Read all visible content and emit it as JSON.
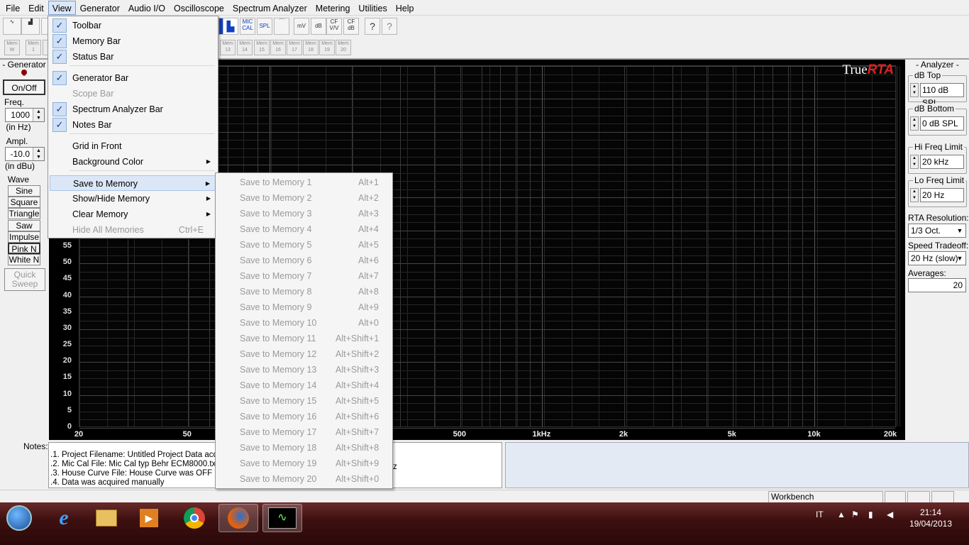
{
  "menubar": [
    "File",
    "Edit",
    "View",
    "Generator",
    "Audio I/O",
    "Oscilloscope",
    "Spectrum Analyzer",
    "Metering",
    "Utilities",
    "Help"
  ],
  "toolbar": {
    "buttons": [
      "MIC CAL",
      "SPL",
      "mV",
      "dB",
      "CF V/V",
      "CF dB",
      "?",
      "?"
    ],
    "mem_label": "Mem",
    "mem_numbers": [
      "W",
      "1",
      "13",
      "14",
      "15",
      "16",
      "17",
      "18",
      "19",
      "20"
    ]
  },
  "generator": {
    "title": "- Generator -",
    "onoff": "On/Off",
    "freq_label": "Freq.",
    "freq_value": "1000",
    "freq_unit": "(in Hz)",
    "ampl_label": "Ampl.",
    "ampl_value": "-10.0",
    "ampl_unit": "(in dBu)",
    "wave_label": "Wave",
    "waves": [
      "Sine",
      "Square",
      "Triangle",
      "Saw",
      "Impulse",
      "Pink N",
      "White N"
    ],
    "quick_sweep": "Quick Sweep"
  },
  "chart_data": {
    "type": "line",
    "logo_text": "True",
    "logo_accent": "RTA",
    "y_ticks": [
      "55",
      "50",
      "45",
      "40",
      "35",
      "30",
      "25",
      "20",
      "15",
      "10",
      "5",
      "0"
    ],
    "x_ticks": [
      "20",
      "50",
      "500",
      "1kHz",
      "2k",
      "5k",
      "10k",
      "20k"
    ],
    "xscale": "log",
    "xlim": [
      20,
      20000
    ],
    "series": []
  },
  "analyzer": {
    "title": "- Analyzer -",
    "db_top_label": "dB Top",
    "db_top_value": "110 dB SPL",
    "db_bottom_label": "dB Bottom",
    "db_bottom_value": "0 dB SPL",
    "hi_freq_label": "Hi Freq Limit",
    "hi_freq_value": "20 kHz",
    "lo_freq_label": "Lo Freq Limit",
    "lo_freq_value": "20 Hz",
    "rta_res_label": "RTA Resolution:",
    "rta_res_value": "1/3 Oct.",
    "speed_label": "Speed Tradeoff:",
    "speed_value": "20 Hz (slow)",
    "averages_label": "Averages:",
    "averages_value": "20"
  },
  "notes": {
    "label": "Notes:",
    "lines": [
      ".1. Project Filename: Untitled Project      Data acq",
      ".2. Mic Cal File: Mic Cal typ Behr ECM8000.txt",
      ".3. House Curve File: House Curve was OFF",
      ".4. Data was acquired manually"
    ],
    "tail": "z"
  },
  "statusbar": {
    "workbench": "Workbench"
  },
  "view_menu": {
    "items": [
      {
        "label": "Toolbar",
        "checked": true
      },
      {
        "label": "Memory Bar",
        "checked": true
      },
      {
        "label": "Status Bar",
        "checked": true
      },
      {
        "label": "Generator Bar",
        "checked": true
      },
      {
        "label": "Scope Bar",
        "checked": false,
        "disabled": true
      },
      {
        "label": "Spectrum Analyzer Bar",
        "checked": true
      },
      {
        "label": "Notes Bar",
        "checked": true
      },
      {
        "label": "Grid in Front"
      },
      {
        "label": "Background Color",
        "submenu": true
      },
      {
        "label": "Save to Memory",
        "submenu": true,
        "highlighted": true
      },
      {
        "label": "Show/Hide Memory",
        "submenu": true
      },
      {
        "label": "Clear Memory",
        "submenu": true
      },
      {
        "label": "Hide All Memories",
        "shortcut": "Ctrl+E",
        "disabled": true
      }
    ],
    "check_glyph": "✓",
    "arrow_glyph": "▶"
  },
  "memory_submenu": [
    {
      "label": "Save to Memory 1",
      "shortcut": "Alt+1"
    },
    {
      "label": "Save to Memory 2",
      "shortcut": "Alt+2"
    },
    {
      "label": "Save to Memory 3",
      "shortcut": "Alt+3"
    },
    {
      "label": "Save to Memory 4",
      "shortcut": "Alt+4"
    },
    {
      "label": "Save to Memory 5",
      "shortcut": "Alt+5"
    },
    {
      "label": "Save to Memory 6",
      "shortcut": "Alt+6"
    },
    {
      "label": "Save to Memory 7",
      "shortcut": "Alt+7"
    },
    {
      "label": "Save to Memory 8",
      "shortcut": "Alt+8"
    },
    {
      "label": "Save to Memory 9",
      "shortcut": "Alt+9"
    },
    {
      "label": "Save to Memory 10",
      "shortcut": "Alt+0"
    },
    {
      "label": "Save to Memory 11",
      "shortcut": "Alt+Shift+1"
    },
    {
      "label": "Save to Memory 12",
      "shortcut": "Alt+Shift+2"
    },
    {
      "label": "Save to Memory 13",
      "shortcut": "Alt+Shift+3"
    },
    {
      "label": "Save to Memory 14",
      "shortcut": "Alt+Shift+4"
    },
    {
      "label": "Save to Memory 15",
      "shortcut": "Alt+Shift+5"
    },
    {
      "label": "Save to Memory 16",
      "shortcut": "Alt+Shift+6"
    },
    {
      "label": "Save to Memory 17",
      "shortcut": "Alt+Shift+7"
    },
    {
      "label": "Save to Memory 18",
      "shortcut": "Alt+Shift+8"
    },
    {
      "label": "Save to Memory 19",
      "shortcut": "Alt+Shift+9"
    },
    {
      "label": "Save to Memory 20",
      "shortcut": "Alt+Shift+0"
    }
  ],
  "taskbar": {
    "apps": [
      "start-orb",
      "internet-explorer",
      "file-explorer",
      "media-player",
      "chrome",
      "firefox",
      "truerta"
    ],
    "lang": "IT",
    "time": "21:14",
    "date": "19/04/2013"
  }
}
